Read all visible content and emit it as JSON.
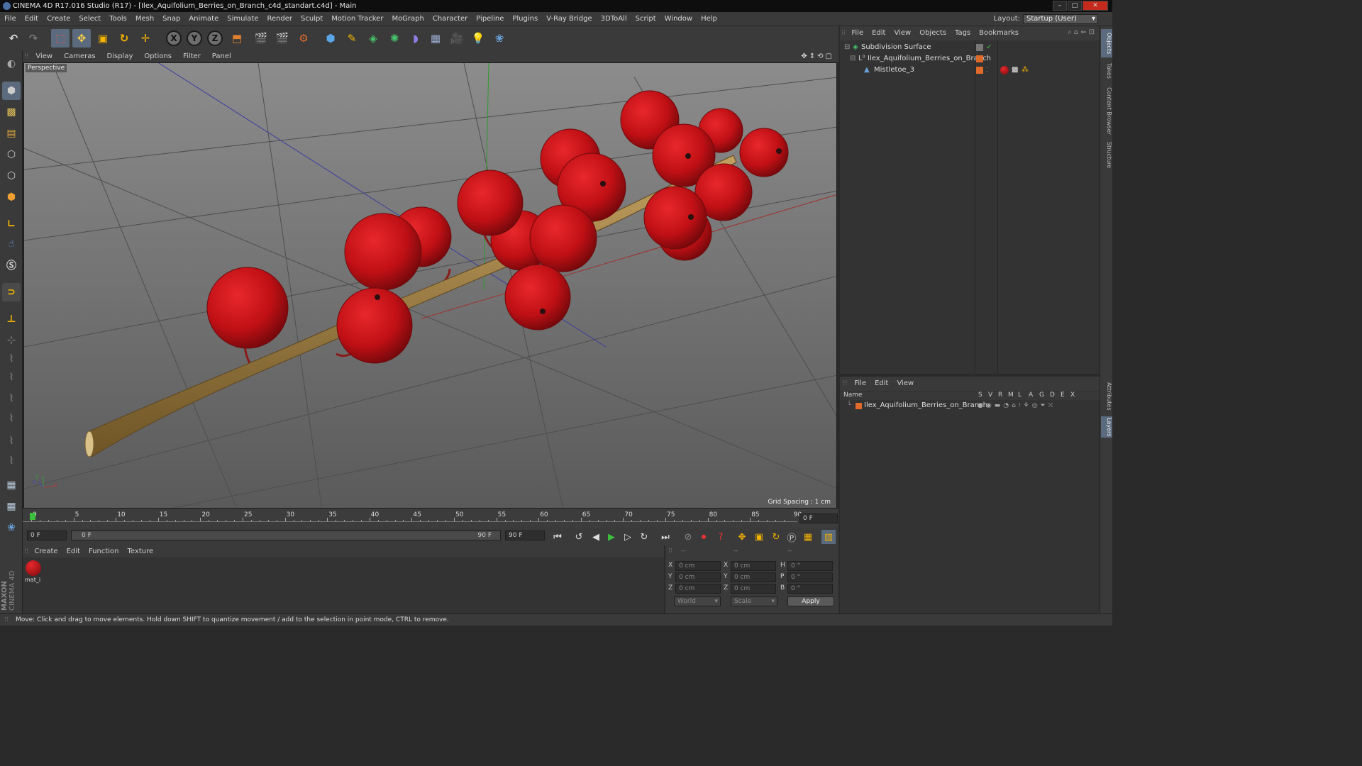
{
  "window": {
    "title": "CINEMA 4D R17.016 Studio (R17) - [Ilex_Aquifolium_Berries_on_Branch_c4d_standart.c4d] - Main"
  },
  "menu": [
    "File",
    "Edit",
    "Create",
    "Select",
    "Tools",
    "Mesh",
    "Snap",
    "Animate",
    "Simulate",
    "Render",
    "Sculpt",
    "Motion Tracker",
    "MoGraph",
    "Character",
    "Pipeline",
    "Plugins",
    "V-Ray Bridge",
    "3DToAll",
    "Script",
    "Window",
    "Help"
  ],
  "layout": {
    "label": "Layout:",
    "value": "Startup (User)"
  },
  "toolbar": {
    "icons": [
      "undo-icon",
      "redo-icon",
      "live-selection-icon",
      "move-icon",
      "scale-icon",
      "rotate-icon",
      "move-cross-icon",
      "x-axis-icon",
      "y-axis-icon",
      "z-axis-icon",
      "world-coords-icon",
      "render-view-icon",
      "render-picture-viewer-icon",
      "edit-render-settings-icon",
      "cube-icon",
      "pen-icon",
      "subdivision-icon",
      "array-icon",
      "deformer-icon",
      "floor-icon",
      "camera-icon",
      "light-icon",
      "python-icon"
    ],
    "axis_x": "X",
    "axis_y": "Y",
    "axis_z": "Z"
  },
  "viewport": {
    "menu": [
      "View",
      "Cameras",
      "Display",
      "Options",
      "Filter",
      "Panel"
    ],
    "label": "Perspective",
    "grid_spacing": "Grid Spacing : 1 cm",
    "axis_x": "x",
    "axis_y": "y",
    "axis_z": "z"
  },
  "timeline": {
    "ticks": [
      "0",
      "5",
      "10",
      "15",
      "20",
      "25",
      "30",
      "35",
      "40",
      "45",
      "50",
      "55",
      "60",
      "65",
      "70",
      "75",
      "80",
      "85",
      "90"
    ],
    "current_frame": "0 F",
    "start_field": "0 F",
    "slider_start": "0 F",
    "slider_end": "90 F",
    "end_field": "90 F"
  },
  "material_manager": {
    "menu": [
      "Create",
      "Edit",
      "Function",
      "Texture"
    ],
    "materials": [
      {
        "name": "mat_i"
      }
    ]
  },
  "coordinates": {
    "headers": [
      "--",
      "--",
      "--"
    ],
    "rows": [
      {
        "a": "X",
        "av": "0 cm",
        "b": "X",
        "bv": "0 cm",
        "c": "H",
        "cv": "0 °"
      },
      {
        "a": "Y",
        "av": "0 cm",
        "b": "Y",
        "bv": "0 cm",
        "c": "P",
        "cv": "0 °"
      },
      {
        "a": "Z",
        "av": "0 cm",
        "b": "Z",
        "bv": "0 cm",
        "c": "B",
        "cv": "0 °"
      }
    ],
    "mode": "World",
    "scale": "Scale",
    "apply": "Apply"
  },
  "object_manager": {
    "menu": [
      "File",
      "Edit",
      "View",
      "Objects",
      "Tags",
      "Bookmarks"
    ],
    "objects": [
      {
        "name": "Subdivision Surface"
      },
      {
        "name": "Ilex_Aquifolium_Berries_on_Branch"
      },
      {
        "name": "Mistletoe_3"
      }
    ]
  },
  "layer_manager": {
    "menu": [
      "File",
      "Edit",
      "View"
    ],
    "columns": [
      "Name",
      "S",
      "V",
      "R",
      "M",
      "L",
      "A",
      "G",
      "D",
      "E",
      "X"
    ],
    "layers": [
      {
        "name": "Ilex_Aquifolium_Berries_on_Branch",
        "color": "#e06a2a"
      }
    ]
  },
  "side_tabs": [
    "Objects",
    "Takes",
    "Content Browser",
    "Structure",
    "Attributes",
    "Layers"
  ],
  "status": "Move: Click and drag to move elements. Hold down SHIFT to quantize movement / add to the selection in point mode, CTRL to remove.",
  "brand": {
    "line1": "MAXON",
    "line2": "CINEMA 4D"
  },
  "colors": {
    "accent": "#5b6a7d",
    "berry": "#c41419",
    "branch": "#9a7a3c"
  }
}
